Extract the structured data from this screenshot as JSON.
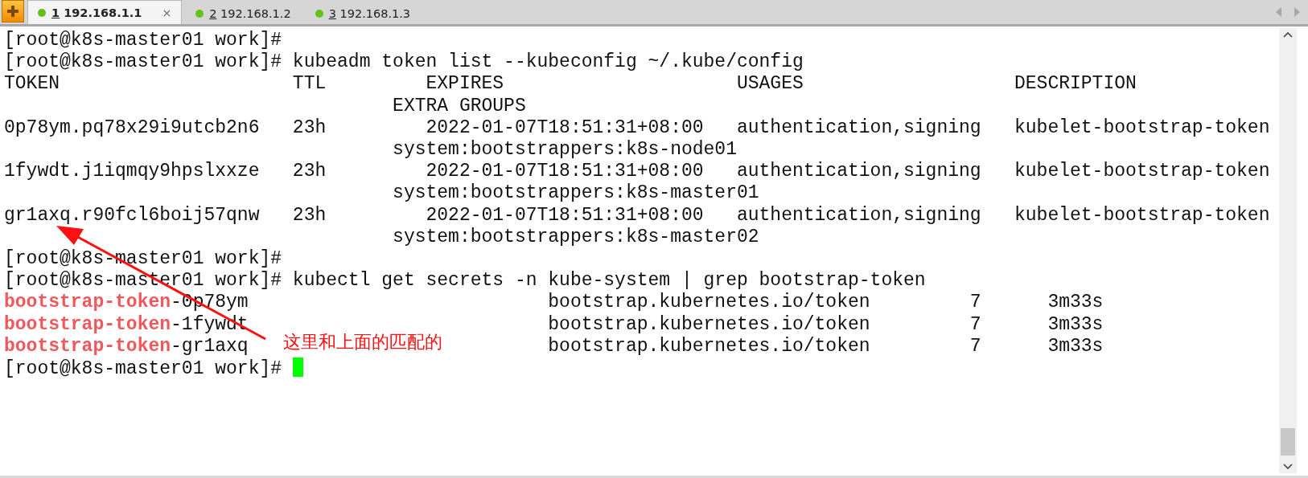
{
  "tabs": [
    {
      "number": "1",
      "label": "192.168.1.1",
      "selected": true,
      "close": "×"
    },
    {
      "number": "2",
      "label": "192.168.1.2",
      "selected": false
    },
    {
      "number": "3",
      "label": "192.168.1.3",
      "selected": false
    }
  ],
  "terminal": {
    "lines": [
      {
        "kind": "plain",
        "text": "[root@k8s-master01 work]#"
      },
      {
        "kind": "plain",
        "text": "[root@k8s-master01 work]# kubeadm token list --kubeconfig ~/.kube/config"
      },
      {
        "kind": "plain",
        "text": "TOKEN                     TTL         EXPIRES                     USAGES                   DESCRIPTION"
      },
      {
        "kind": "plain",
        "text": "                                   EXTRA GROUPS"
      },
      {
        "kind": "plain",
        "text": "0p78ym.pq78x29i9utcb2n6   23h         2022-01-07T18:51:31+08:00   authentication,signing   kubelet-bootstrap-token"
      },
      {
        "kind": "plain",
        "text": "                                   system:bootstrappers:k8s-node01"
      },
      {
        "kind": "plain",
        "text": "1fywdt.j1iqmqy9hpslxxze   23h         2022-01-07T18:51:31+08:00   authentication,signing   kubelet-bootstrap-token"
      },
      {
        "kind": "plain",
        "text": "                                   system:bootstrappers:k8s-master01"
      },
      {
        "kind": "plain",
        "text": "gr1axq.r90fcl6boij57qnw   23h         2022-01-07T18:51:31+08:00   authentication,signing   kubelet-bootstrap-token"
      },
      {
        "kind": "plain",
        "text": "                                   system:bootstrappers:k8s-master02"
      },
      {
        "kind": "plain",
        "text": "[root@k8s-master01 work]#"
      },
      {
        "kind": "plain",
        "text": "[root@k8s-master01 work]# kubectl get secrets -n kube-system | grep bootstrap-token"
      },
      {
        "kind": "secret",
        "match": "bootstrap-token",
        "suffix": "-0p78ym",
        "type": "bootstrap.kubernetes.io/token",
        "data": "7",
        "age": "3m33s"
      },
      {
        "kind": "secret",
        "match": "bootstrap-token",
        "suffix": "-1fywdt",
        "type": "bootstrap.kubernetes.io/token",
        "data": "7",
        "age": "3m33s"
      },
      {
        "kind": "secret",
        "match": "bootstrap-token",
        "suffix": "-gr1axq",
        "type": "bootstrap.kubernetes.io/token",
        "data": "7",
        "age": "3m33s"
      },
      {
        "kind": "prompt",
        "text": "[root@k8s-master01 work]# ",
        "cursor": true
      }
    ]
  },
  "annotation": {
    "text": "这里和上面的匹配的"
  }
}
